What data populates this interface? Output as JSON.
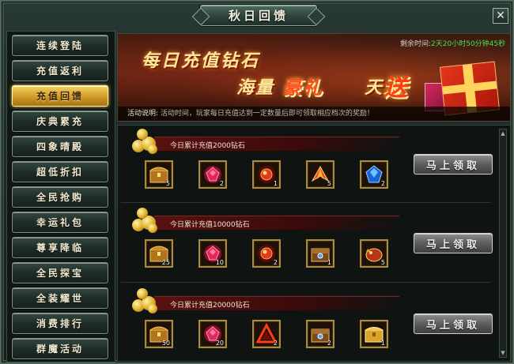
{
  "window": {
    "title": "秋日回馈",
    "close_label": "✕"
  },
  "sidebar": {
    "items": [
      {
        "label": "连续登陆",
        "active": false
      },
      {
        "label": "充值返利",
        "active": false
      },
      {
        "label": "充值回馈",
        "active": true
      },
      {
        "label": "庆典累充",
        "active": false
      },
      {
        "label": "四象晴殿",
        "active": false
      },
      {
        "label": "超低折扣",
        "active": false
      },
      {
        "label": "全民抢购",
        "active": false
      },
      {
        "label": "幸运礼包",
        "active": false
      },
      {
        "label": "尊享降临",
        "active": false
      },
      {
        "label": "全民探宝",
        "active": false
      },
      {
        "label": "全装耀世",
        "active": false
      },
      {
        "label": "消费排行",
        "active": false
      },
      {
        "label": "群魔活动",
        "active": false
      }
    ]
  },
  "banner": {
    "line1": "每日充值钻石",
    "line2_a": "海量",
    "line2_b": "豪礼",
    "line2_c": "天天",
    "line2_d": "送",
    "countdown_label": "剩余时间:",
    "countdown_value": "2天20小时50分钟45秒",
    "desc_label": "活动说明:",
    "desc_text": "活动时间，玩家每日充值达到一定数量后即可领取相应档次的奖励！"
  },
  "tiers": [
    {
      "label": "今日累计充值2000钻石",
      "claim_label": "马上领取",
      "items": [
        {
          "icon": "treasure-chest-icon",
          "qty": "5"
        },
        {
          "icon": "ruby-gem-icon",
          "qty": "2"
        },
        {
          "icon": "fire-orb-icon",
          "qty": "1"
        },
        {
          "icon": "phoenix-wing-icon",
          "qty": "5"
        },
        {
          "icon": "sapphire-gem-icon",
          "qty": "2"
        }
      ]
    },
    {
      "label": "今日累计充值10000钻石",
      "claim_label": "马上领取",
      "items": [
        {
          "icon": "treasure-chest-icon",
          "qty": "25"
        },
        {
          "icon": "ruby-gem-icon",
          "qty": "10"
        },
        {
          "icon": "fire-orb-icon",
          "qty": "2"
        },
        {
          "icon": "ornate-chest-icon",
          "qty": "1"
        },
        {
          "icon": "dragon-pet-icon",
          "qty": "5"
        }
      ]
    },
    {
      "label": "今日累计充值20000钻石",
      "claim_label": "马上领取",
      "items": [
        {
          "icon": "treasure-chest-icon",
          "qty": "50"
        },
        {
          "icon": "ruby-gem-icon",
          "qty": "20"
        },
        {
          "icon": "triangle-rune-icon",
          "qty": "2"
        },
        {
          "icon": "ornate-chest-icon",
          "qty": "2"
        },
        {
          "icon": "golden-chest-icon",
          "qty": "1"
        }
      ]
    }
  ],
  "colors": {
    "active_tab": "#d29a27",
    "frame": "#273a33",
    "item_border": "#a98c3e",
    "countdown_value": "#48e24a"
  }
}
